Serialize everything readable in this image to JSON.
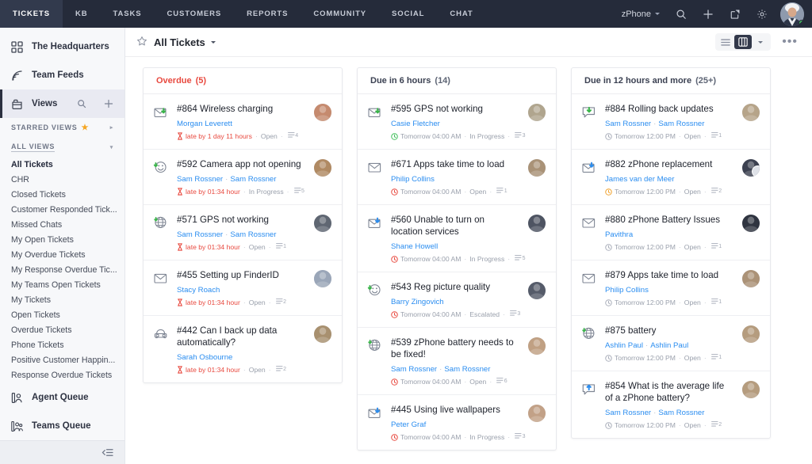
{
  "topnav": {
    "tabs": [
      {
        "label": "TICKETS",
        "active": true
      },
      {
        "label": "KB",
        "active": false
      },
      {
        "label": "TASKS",
        "active": false
      },
      {
        "label": "CUSTOMERS",
        "active": false
      },
      {
        "label": "REPORTS",
        "active": false
      },
      {
        "label": "COMMUNITY",
        "active": false
      },
      {
        "label": "SOCIAL",
        "active": false
      },
      {
        "label": "CHAT",
        "active": false
      }
    ],
    "product": "zPhone",
    "icons": [
      "search-icon",
      "plus-icon",
      "launch-icon",
      "gear-icon"
    ],
    "avatar": "user-avatar"
  },
  "sidebar": {
    "top_items": [
      {
        "label": "The Headquarters",
        "icon": "grid-icon",
        "active": false
      },
      {
        "label": "Team Feeds",
        "icon": "feed-icon",
        "active": false
      },
      {
        "label": "Views",
        "icon": "views-icon",
        "active": true,
        "actions": [
          "search-icon",
          "plus-icon"
        ]
      }
    ],
    "starred_section": {
      "label": "STARRED VIEWS",
      "star": "★",
      "arrow": "▸"
    },
    "all_section": {
      "label": "ALL VIEWS",
      "arrow": "▾"
    },
    "views": [
      {
        "label": "All Tickets",
        "selected": true
      },
      {
        "label": "CHR",
        "selected": false
      },
      {
        "label": "Closed Tickets",
        "selected": false
      },
      {
        "label": "Customer Responded Tick...",
        "selected": false
      },
      {
        "label": "Missed Chats",
        "selected": false
      },
      {
        "label": "My Open Tickets",
        "selected": false
      },
      {
        "label": "My Overdue Tickets",
        "selected": false
      },
      {
        "label": "My Response Overdue Tic...",
        "selected": false
      },
      {
        "label": "My Teams Open Tickets",
        "selected": false
      },
      {
        "label": "My Tickets",
        "selected": false
      },
      {
        "label": "Open Tickets",
        "selected": false
      },
      {
        "label": "Overdue Tickets",
        "selected": false
      },
      {
        "label": "Phone Tickets",
        "selected": false
      },
      {
        "label": "Positive Customer Happin...",
        "selected": false
      },
      {
        "label": "Response Overdue Tickets",
        "selected": false
      }
    ],
    "bottom_items": [
      {
        "label": "Agent Queue",
        "icon": "agent-queue-icon"
      },
      {
        "label": "Teams Queue",
        "icon": "teams-queue-icon"
      }
    ],
    "collapse": "collapse-sidebar-icon"
  },
  "main_header": {
    "star_icon": "star-outline-icon",
    "title": "All Tickets",
    "caret": "▾",
    "view_list_icon": "list-view-icon",
    "view_board_icon": "board-view-icon",
    "view_more_caret": "▾",
    "more_dots": "•••"
  },
  "board": {
    "columns": [
      {
        "name": "Overdue",
        "count": "(5)",
        "overdue": true,
        "cards": [
          {
            "icon": "email-incoming-icon",
            "title": "#864 Wireless charging",
            "people": [
              "Morgan Leverett"
            ],
            "due": "late by 1 day 11 hours",
            "due_state": "late",
            "status": "Open",
            "conversations": "4",
            "avatar_color": "#c58a6e",
            "dual_avatar": false
          },
          {
            "icon": "happiness-icon",
            "title": "#592 Camera app not opening",
            "people": [
              "Sam Rossner",
              "Sam Rossner"
            ],
            "due": "late by 01:34 hour",
            "due_state": "late",
            "status": "In Progress",
            "conversations": "5",
            "avatar_color": "#b08a63",
            "dual_avatar": false
          },
          {
            "icon": "portal-globe-icon",
            "title": "#571 GPS not working",
            "people": [
              "Sam Rossner",
              "Sam Rossner"
            ],
            "due": "late by 01:34 hour",
            "due_state": "late",
            "status": "Open",
            "conversations": "1",
            "avatar_color": "#5f6672",
            "dual_avatar": false
          },
          {
            "icon": "email-icon",
            "title": "#455 Setting up FinderID",
            "people": [
              "Stacy Roach"
            ],
            "due": "late by 01:34 hour",
            "due_state": "late",
            "status": "Open",
            "conversations": "2",
            "avatar_color": "#9aa6b8",
            "dual_avatar": false
          },
          {
            "icon": "phone-icon",
            "title": "#442 Can I back up data automatically?",
            "people": [
              "Sarah Osbourne"
            ],
            "due": "late by 01:34 hour",
            "due_state": "late",
            "status": "Open",
            "conversations": "2",
            "avatar_color": "#a8906f",
            "dual_avatar": false
          }
        ]
      },
      {
        "name": "Due in 6 hours",
        "count": "(14)",
        "overdue": false,
        "cards": [
          {
            "icon": "email-incoming-icon",
            "title": "#595 GPS not working",
            "people": [
              "Casie Fletcher"
            ],
            "due": "Tomorrow 04:00 AM",
            "due_state": "ok",
            "status": "In Progress",
            "conversations": "3",
            "avatar_color": "#b0a58e",
            "dual_avatar": false
          },
          {
            "icon": "email-icon",
            "title": "#671 Apps take time to load",
            "people": [
              "Philip Collins"
            ],
            "due": "Tomorrow 04:00 AM",
            "due_state": "late",
            "status": "Open",
            "conversations": "1",
            "avatar_color": "#a99277",
            "dual_avatar": false
          },
          {
            "icon": "email-outgoing-icon",
            "title": "#560 Unable to turn on location services",
            "people": [
              "Shane Howell"
            ],
            "due": "Tomorrow 04:00 AM",
            "due_state": "late",
            "status": "In Progress",
            "conversations": "5",
            "avatar_color": "#4e5462",
            "dual_avatar": false
          },
          {
            "icon": "happiness-icon",
            "title": "#543 Reg picture quality",
            "people": [
              "Barry Zingovich"
            ],
            "due": "Tomorrow 04:00 AM",
            "due_state": "late",
            "status": "Escalated",
            "conversations": "3",
            "avatar_color": "#555b69",
            "dual_avatar": false
          },
          {
            "icon": "portal-globe-icon",
            "title": "#539 zPhone battery needs to be fixed!",
            "people": [
              "Sam Rossner",
              "Sam Rossner"
            ],
            "due": "Tomorrow 04:00 AM",
            "due_state": "late",
            "status": "Open",
            "conversations": "6",
            "avatar_color": "#c0a083",
            "dual_avatar": false
          },
          {
            "icon": "email-outgoing-icon",
            "title": "#445 Using live wallpapers",
            "people": [
              "Peter Graf"
            ],
            "due": "Tomorrow 04:00 AM",
            "due_state": "late",
            "status": "In Progress",
            "conversations": "3",
            "avatar_color": "#c2a187",
            "dual_avatar": false
          }
        ]
      },
      {
        "name": "Due in 12 hours and more",
        "count": "(25+)",
        "overdue": false,
        "cards": [
          {
            "icon": "chat-incoming-icon",
            "title": "#884 Rolling back updates",
            "people": [
              "Sam Rossner",
              "Sam Rossner"
            ],
            "due": "Tomorrow 12:00 PM",
            "due_state": "neutral",
            "status": "Open",
            "conversations": "1",
            "avatar_color": "#b6a489",
            "dual_avatar": false
          },
          {
            "icon": "email-outgoing-icon",
            "title": "#882 zPhone replacement",
            "people": [
              "James van der Meer"
            ],
            "due": "Tomorrow 12:00 PM",
            "due_state": "warn",
            "status": "Open",
            "conversations": "2",
            "avatar_color": "#3c4150",
            "dual_avatar": true
          },
          {
            "icon": "email-icon",
            "title": "#880 zPhone Battery Issues",
            "people": [
              "Pavithra"
            ],
            "due": "Tomorrow 12:00 PM",
            "due_state": "neutral",
            "status": "Open",
            "conversations": "1",
            "avatar_color": "#2f3440",
            "dual_avatar": false
          },
          {
            "icon": "email-icon",
            "title": "#879 Apps take time to load",
            "people": [
              "Philip Collins"
            ],
            "due": "Tomorrow 12:00 PM",
            "due_state": "neutral",
            "status": "Open",
            "conversations": "1",
            "avatar_color": "#ab9277",
            "dual_avatar": false
          },
          {
            "icon": "portal-globe-icon",
            "title": "#875 battery",
            "people": [
              "Ashlin Paul",
              "Ashlin Paul"
            ],
            "due": "Tomorrow 12:00 PM",
            "due_state": "neutral",
            "status": "Open",
            "conversations": "1",
            "avatar_color": "#b59c7e",
            "dual_avatar": false
          },
          {
            "icon": "chat-outgoing-icon",
            "title": "#854 What is the average life of a zPhone battery?",
            "people": [
              "Sam Rossner",
              "Sam Rossner"
            ],
            "due": "Tomorrow 12:00 PM",
            "due_state": "neutral",
            "status": "Open",
            "conversations": "2",
            "avatar_color": "#b59c7e",
            "dual_avatar": false
          }
        ]
      }
    ]
  },
  "colors": {
    "topnav_bg": "#252b3a",
    "topnav_active": "#323a4d",
    "accent_link": "#2a8df0",
    "overdue_red": "#e8493f",
    "warn_amber": "#f0a22e",
    "ok_green": "#3fbf5a",
    "sidebar_bg": "#f7f8fa"
  }
}
